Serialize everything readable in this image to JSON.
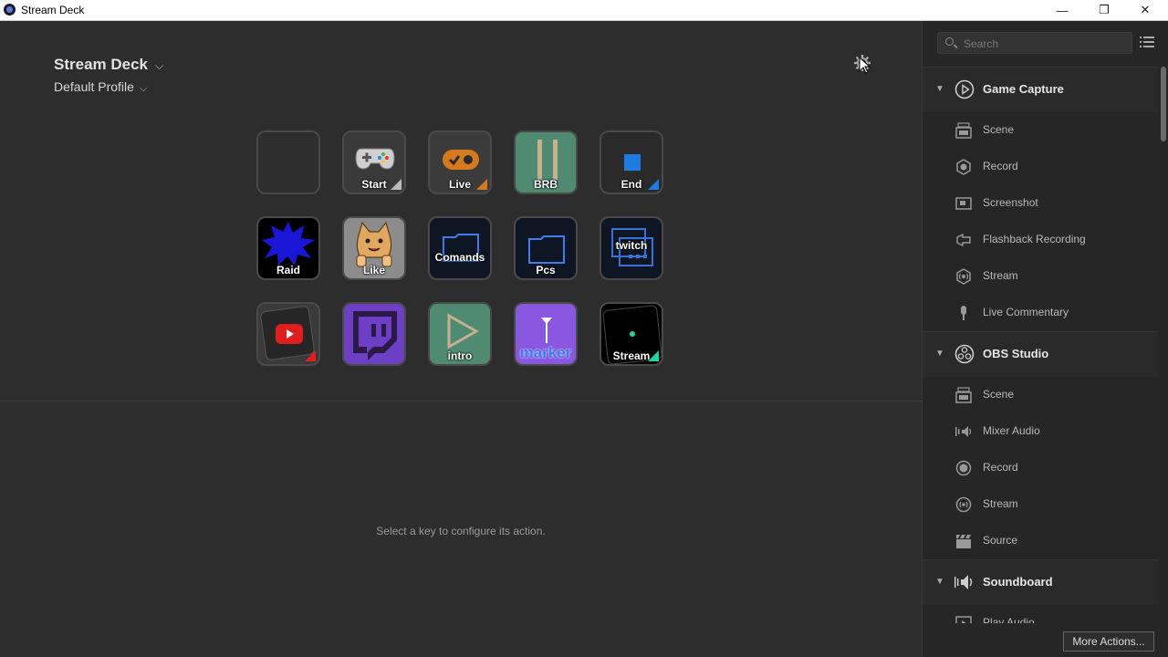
{
  "window": {
    "title": "Stream Deck",
    "minimize_glyph": "—",
    "restore_glyph": "❐",
    "close_glyph": "✕"
  },
  "device": {
    "name": "Stream Deck",
    "profile": "Default Profile",
    "chevron": "⌵"
  },
  "keys": [
    {
      "label": "",
      "bg": "#2e2e2e"
    },
    {
      "label": "Start",
      "bg": "#3a3a3a"
    },
    {
      "label": "Live",
      "bg": "#3b3b3b"
    },
    {
      "label": "BRB",
      "bg": "#4f8a73"
    },
    {
      "label": "End",
      "bg": "#2a2a2a"
    },
    {
      "label": "Raid",
      "bg": "#000000"
    },
    {
      "label": "Like",
      "bg": "#8c8c8c"
    },
    {
      "label": "Comands",
      "bg": "#0d1622"
    },
    {
      "label": "Pcs",
      "bg": "#0d1622"
    },
    {
      "label": "twitch",
      "bg": "#0d1622"
    },
    {
      "label": "",
      "bg": "#3a3a3a"
    },
    {
      "label": "",
      "bg": "#6c3fc4"
    },
    {
      "label": "intro",
      "bg": "#4f8a73"
    },
    {
      "label": "marker",
      "bg": "#8a57e0"
    },
    {
      "label": "Stream",
      "bg": "#000000"
    }
  ],
  "hint": "Select a key to configure its action.",
  "sidebar": {
    "search_placeholder": "Search",
    "categories": [
      {
        "label": "Game Capture",
        "icon": "play-circle-icon",
        "actions": [
          {
            "label": "Scene",
            "icon": "scene-icon"
          },
          {
            "label": "Record",
            "icon": "record-hex-icon"
          },
          {
            "label": "Screenshot",
            "icon": "screenshot-icon"
          },
          {
            "label": "Flashback Recording",
            "icon": "flashback-icon"
          },
          {
            "label": "Stream",
            "icon": "stream-icon"
          },
          {
            "label": "Live Commentary",
            "icon": "microphone-icon"
          }
        ]
      },
      {
        "label": "OBS Studio",
        "icon": "obs-icon",
        "actions": [
          {
            "label": "Scene",
            "icon": "scene-icon"
          },
          {
            "label": "Mixer Audio",
            "icon": "mixer-audio-icon"
          },
          {
            "label": "Record",
            "icon": "record-icon"
          },
          {
            "label": "Stream",
            "icon": "stream-icon"
          },
          {
            "label": "Source",
            "icon": "source-icon"
          }
        ]
      },
      {
        "label": "Soundboard",
        "icon": "speaker-icon",
        "actions": [
          {
            "label": "Play Audio",
            "icon": "play-audio-icon"
          }
        ]
      }
    ],
    "more_actions": "More Actions..."
  },
  "colors": {
    "background": "#2d2d2d",
    "sidebar": "#262626",
    "twitch_purple": "#6c3fc4"
  }
}
